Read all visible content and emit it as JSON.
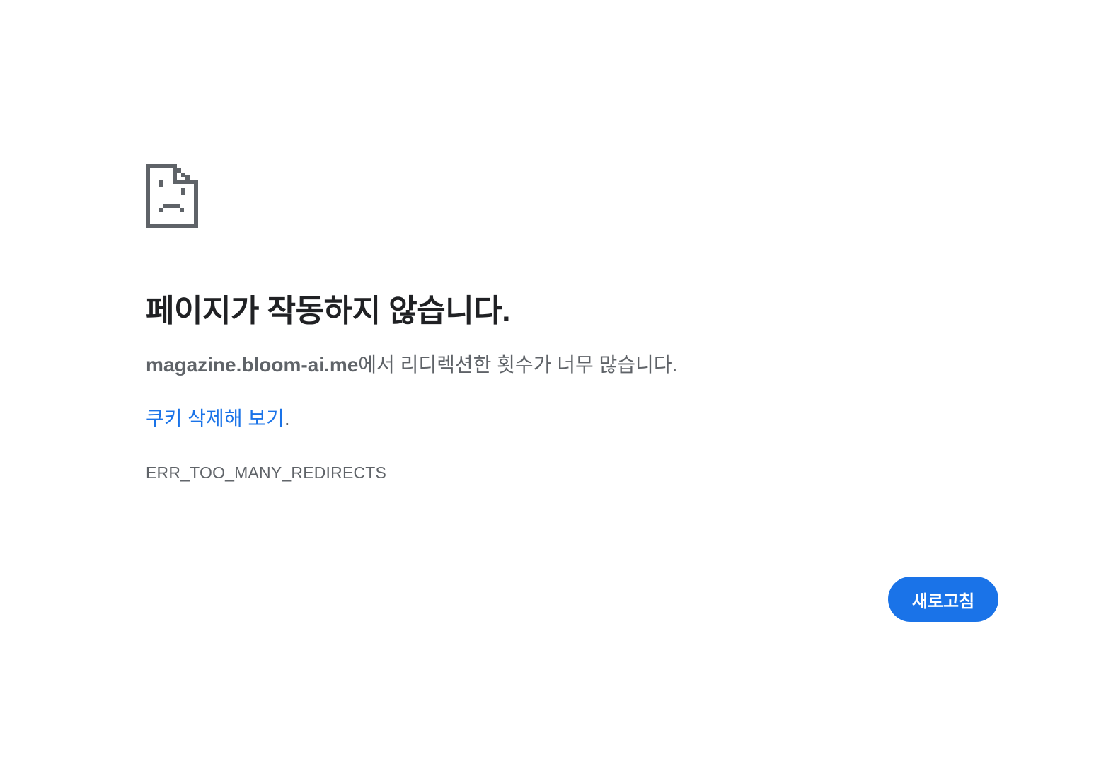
{
  "page": {
    "icon": "sad-page-icon",
    "title": "페이지가 작동하지 않습니다.",
    "summary": {
      "host": "magazine.bloom-ai.me",
      "message": "에서 리디렉션한 횟수가 너무 많습니다."
    },
    "suggestion": {
      "link_text": "쿠키 삭제해 보기",
      "suffix": "."
    },
    "error_code": "ERR_TOO_MANY_REDIRECTS",
    "reload_label": "새로고침"
  },
  "colors": {
    "accent": "#1a73e8",
    "title": "#202124",
    "secondary_text": "#5f6368",
    "icon": "#5f6368"
  }
}
